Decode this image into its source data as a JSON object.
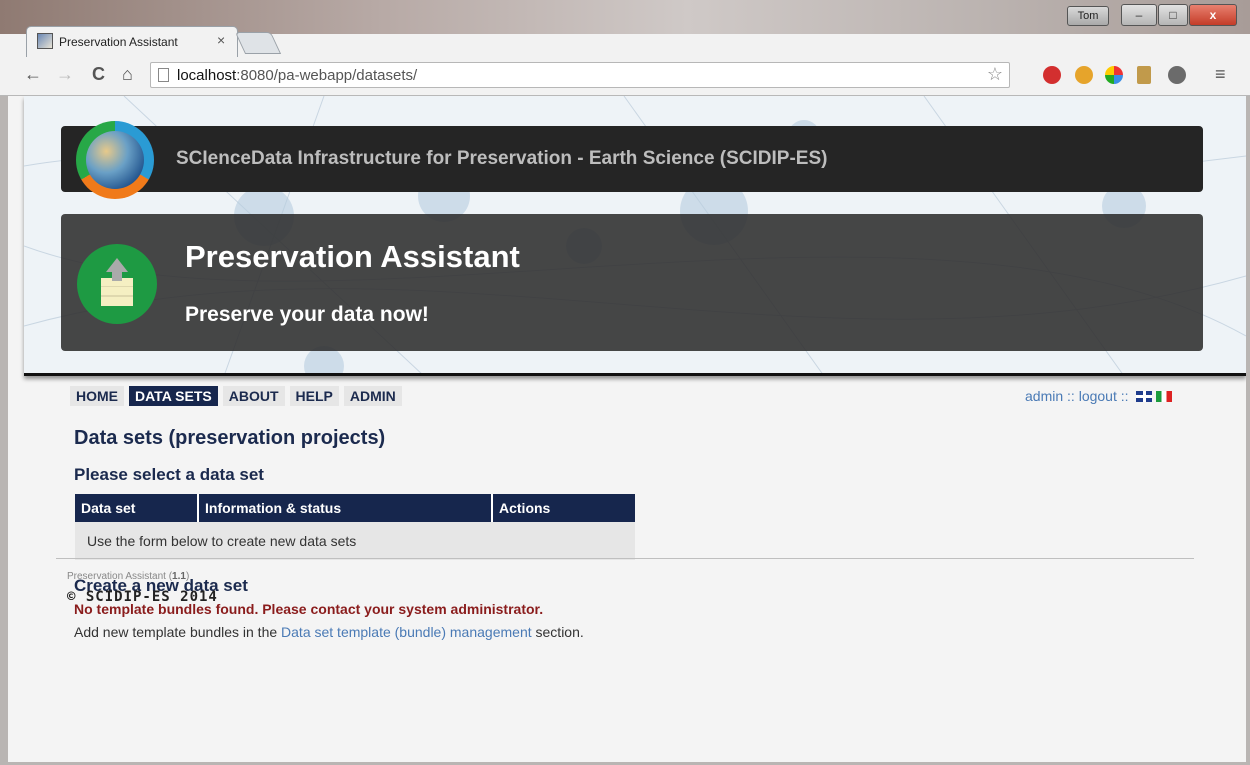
{
  "browser": {
    "tab_title": "Preservation Assistant",
    "tab_close": "×",
    "user_badge": "Tom",
    "window_buttons": [
      "–",
      "□",
      "x"
    ],
    "url_host": "localhost",
    "url_rest": ":8080/pa-webapp/datasets/",
    "nav_back": "←",
    "nav_forward": "→",
    "nav_reload": "C",
    "nav_home": "⌂",
    "bookmark_star": "☆",
    "menu": "≡",
    "extension_colors": [
      "#d32f2f",
      "#e6a42b",
      "#3a8ee6",
      "#c19a4b",
      "#6b6b6b"
    ]
  },
  "header": {
    "site_title": "SCIenceData Infrastructure for Preservation - Earth Science (SCIDIP-ES)",
    "hero_title": "Preservation Assistant",
    "hero_subtitle": "Preserve your data now!"
  },
  "nav": {
    "items": [
      {
        "label": "HOME",
        "active": false
      },
      {
        "label": "DATA SETS",
        "active": true
      },
      {
        "label": "ABOUT",
        "active": false
      },
      {
        "label": "HELP",
        "active": false
      },
      {
        "label": "ADMIN",
        "active": false
      }
    ],
    "user": "admin",
    "sep": " :: ",
    "logout": "logout"
  },
  "main": {
    "title": "Data sets (preservation projects)",
    "select_heading": "Please select a data set",
    "table": {
      "columns": [
        "Data set",
        "Information & status",
        "Actions"
      ],
      "empty_text": "Use the form below to create new data sets"
    },
    "create_heading": "Create a new data set",
    "error": "No template bundles found. Please contact your system administrator.",
    "add_prefix": "Add new template bundles in the ",
    "add_link": "Data set template (bundle) management",
    "add_suffix": " section."
  },
  "footer": {
    "app_name": "Preservation Assistant (",
    "version": "1.1",
    "app_close": ")",
    "copyright": "© SCIDIP-ES 2014"
  },
  "colors": {
    "nav_active": "#16264d",
    "error": "#8a1c1c",
    "link": "#4a7ab5"
  }
}
